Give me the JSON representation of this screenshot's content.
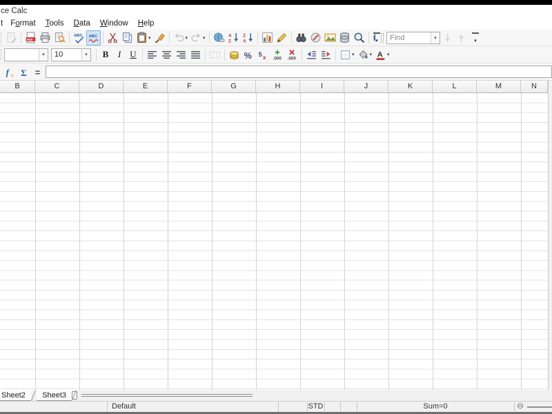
{
  "window": {
    "title_visible": "ce Calc"
  },
  "menu": {
    "items": [
      {
        "name": "menu-item-partial",
        "pre": "t",
        "accel": "",
        "post": ""
      },
      {
        "name": "menu-item-format",
        "pre": "F",
        "accel": "o",
        "post": "rmat"
      },
      {
        "name": "menu-item-tools",
        "pre": "",
        "accel": "T",
        "post": "ools"
      },
      {
        "name": "menu-item-data",
        "pre": "",
        "accel": "D",
        "post": "ata"
      },
      {
        "name": "menu-item-window",
        "pre": "",
        "accel": "W",
        "post": "indow"
      },
      {
        "name": "menu-item-help",
        "pre": "",
        "accel": "H",
        "post": "elp"
      }
    ]
  },
  "toolbar_standard": {
    "items": [
      {
        "type": "icon",
        "name": "edit-file",
        "icon": "edit-file",
        "disabled": true
      },
      {
        "type": "sep"
      },
      {
        "type": "icon",
        "name": "export-pdf",
        "icon": "pdf"
      },
      {
        "type": "icon",
        "name": "print",
        "icon": "print"
      },
      {
        "type": "icon",
        "name": "page-preview",
        "icon": "preview"
      },
      {
        "type": "sep"
      },
      {
        "type": "icon",
        "name": "spelling",
        "icon": "spelling"
      },
      {
        "type": "icon",
        "name": "auto-spellcheck",
        "icon": "autospell",
        "selected": true
      },
      {
        "type": "sep"
      },
      {
        "type": "icon",
        "name": "cut",
        "icon": "cut"
      },
      {
        "type": "icon",
        "name": "copy",
        "icon": "copy"
      },
      {
        "type": "icon",
        "name": "paste",
        "icon": "paste",
        "dropdown": true
      },
      {
        "type": "icon",
        "name": "format-paintbrush",
        "icon": "brush"
      },
      {
        "type": "sep"
      },
      {
        "type": "icon",
        "name": "undo",
        "icon": "undo",
        "disabled": true,
        "dropdown": true
      },
      {
        "type": "icon",
        "name": "redo",
        "icon": "redo",
        "disabled": true,
        "dropdown": true
      },
      {
        "type": "sep"
      },
      {
        "type": "icon",
        "name": "hyperlink",
        "icon": "hyperlink"
      },
      {
        "type": "icon",
        "name": "sort-ascending",
        "icon": "sort-asc"
      },
      {
        "type": "icon",
        "name": "sort-descending",
        "icon": "sort-desc"
      },
      {
        "type": "sep"
      },
      {
        "type": "icon",
        "name": "insert-chart",
        "icon": "chart"
      },
      {
        "type": "icon",
        "name": "show-draw-functions",
        "icon": "draw"
      },
      {
        "type": "sep"
      },
      {
        "type": "icon",
        "name": "find-and-replace",
        "icon": "find"
      },
      {
        "type": "icon",
        "name": "navigator",
        "icon": "navigator"
      },
      {
        "type": "icon",
        "name": "gallery",
        "icon": "gallery"
      },
      {
        "type": "icon",
        "name": "data-sources",
        "icon": "datasource"
      },
      {
        "type": "icon",
        "name": "zoom",
        "icon": "zoom"
      },
      {
        "type": "sep"
      },
      {
        "type": "icon",
        "name": "help",
        "icon": "help"
      }
    ]
  },
  "find_toolbar": {
    "placeholder": "Find",
    "buttons": [
      {
        "name": "find-next",
        "icon": "arrow-down",
        "disabled": true
      },
      {
        "name": "find-previous",
        "icon": "arrow-up",
        "disabled": true
      }
    ]
  },
  "toolbar_formatting": {
    "items": [
      {
        "type": "combo",
        "name": "font-name",
        "value": "",
        "width": 64
      },
      {
        "type": "combo",
        "name": "font-size",
        "value": "10",
        "width": 58
      },
      {
        "type": "sep"
      },
      {
        "type": "text",
        "name": "bold",
        "label": "B",
        "style": "bold"
      },
      {
        "type": "text",
        "name": "italic",
        "label": "I",
        "style": "italic"
      },
      {
        "type": "text",
        "name": "underline",
        "label": "U",
        "style": "underline"
      },
      {
        "type": "sep"
      },
      {
        "type": "icon",
        "name": "align-left",
        "icon": "align-left"
      },
      {
        "type": "icon",
        "name": "align-center",
        "icon": "align-center"
      },
      {
        "type": "icon",
        "name": "align-right",
        "icon": "align-right"
      },
      {
        "type": "icon",
        "name": "align-justify",
        "icon": "align-justify"
      },
      {
        "type": "sep"
      },
      {
        "type": "icon",
        "name": "merge-cells",
        "icon": "merge",
        "disabled": true
      },
      {
        "type": "sep"
      },
      {
        "type": "icon",
        "name": "number-format-currency",
        "icon": "currency"
      },
      {
        "type": "icon",
        "name": "number-format-percent",
        "icon": "percent"
      },
      {
        "type": "icon",
        "name": "number-format-standard",
        "icon": "numstd"
      },
      {
        "type": "icon",
        "name": "add-decimal-place",
        "icon": "adddec"
      },
      {
        "type": "icon",
        "name": "delete-decimal-place",
        "icon": "deldec"
      },
      {
        "type": "sep"
      },
      {
        "type": "icon",
        "name": "decrease-indent",
        "icon": "indent-dec"
      },
      {
        "type": "icon",
        "name": "increase-indent",
        "icon": "indent-inc"
      },
      {
        "type": "sep"
      },
      {
        "type": "icon",
        "name": "borders",
        "icon": "borders",
        "dropdown": true
      },
      {
        "type": "icon",
        "name": "background-color",
        "icon": "bgcolor",
        "dropdown": true
      },
      {
        "type": "icon",
        "name": "font-color",
        "icon": "fontcolor",
        "dropdown": true
      }
    ]
  },
  "formula_bar": {
    "input_value": ""
  },
  "sheet_area": {
    "column_headers": [
      "B",
      "C",
      "D",
      "E",
      "F",
      "G",
      "H",
      "I",
      "J",
      "K",
      "L",
      "M",
      "N"
    ]
  },
  "sheet_tabs": [
    "Sheet2",
    "Sheet3"
  ],
  "status_bar": {
    "page_style": "Default",
    "selection_mode": "STD",
    "sum": "Sum=0",
    "zoom_out_glyph": "⊖"
  },
  "colors": {
    "selected_button_bg": "#cfe4f7",
    "selected_button_border": "#84b4dc",
    "grid_line": "#d9d9d9",
    "top_strip": "#000000"
  }
}
